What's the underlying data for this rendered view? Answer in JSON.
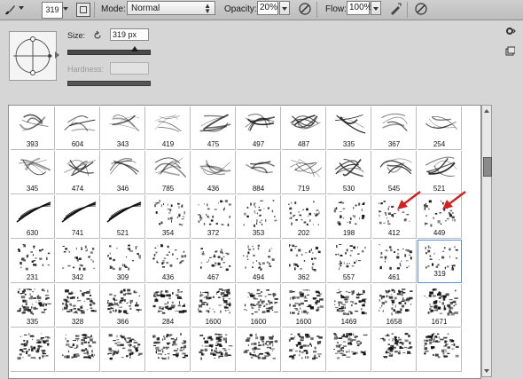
{
  "options_bar": {
    "brush_size": "319",
    "mode_label": "Mode:",
    "mode_value": "Normal",
    "opacity_label": "Opacity:",
    "opacity_value": "20%",
    "flow_label": "Flow:",
    "flow_value": "100%"
  },
  "brush_panel": {
    "size_label": "Size:",
    "size_value": "319 px",
    "hardness_label": "Hardness:"
  },
  "grid": {
    "rows": [
      [
        "393",
        "604",
        "343",
        "419",
        "475",
        "497",
        "487",
        "335",
        "367",
        "254"
      ],
      [
        "345",
        "474",
        "346",
        "785",
        "436",
        "884",
        "719",
        "530",
        "545",
        "521"
      ],
      [
        "630",
        "741",
        "521",
        "354",
        "372",
        "353",
        "202",
        "198",
        "412",
        "449"
      ],
      [
        "231",
        "342",
        "309",
        "436",
        "467",
        "494",
        "362",
        "557",
        "461",
        "319"
      ],
      [
        "335",
        "328",
        "366",
        "284",
        "1600",
        "1600",
        "1600",
        "1469",
        "1658",
        "1671"
      ],
      [
        "",
        "",
        "",
        "",
        "",
        "",
        "",
        "",
        "",
        ""
      ]
    ],
    "selected": {
      "row": 3,
      "col": 9
    },
    "arrow_color": "#d42020",
    "arrow_targets": [
      {
        "row": 2,
        "col": 8
      },
      {
        "row": 2,
        "col": 9
      }
    ]
  }
}
